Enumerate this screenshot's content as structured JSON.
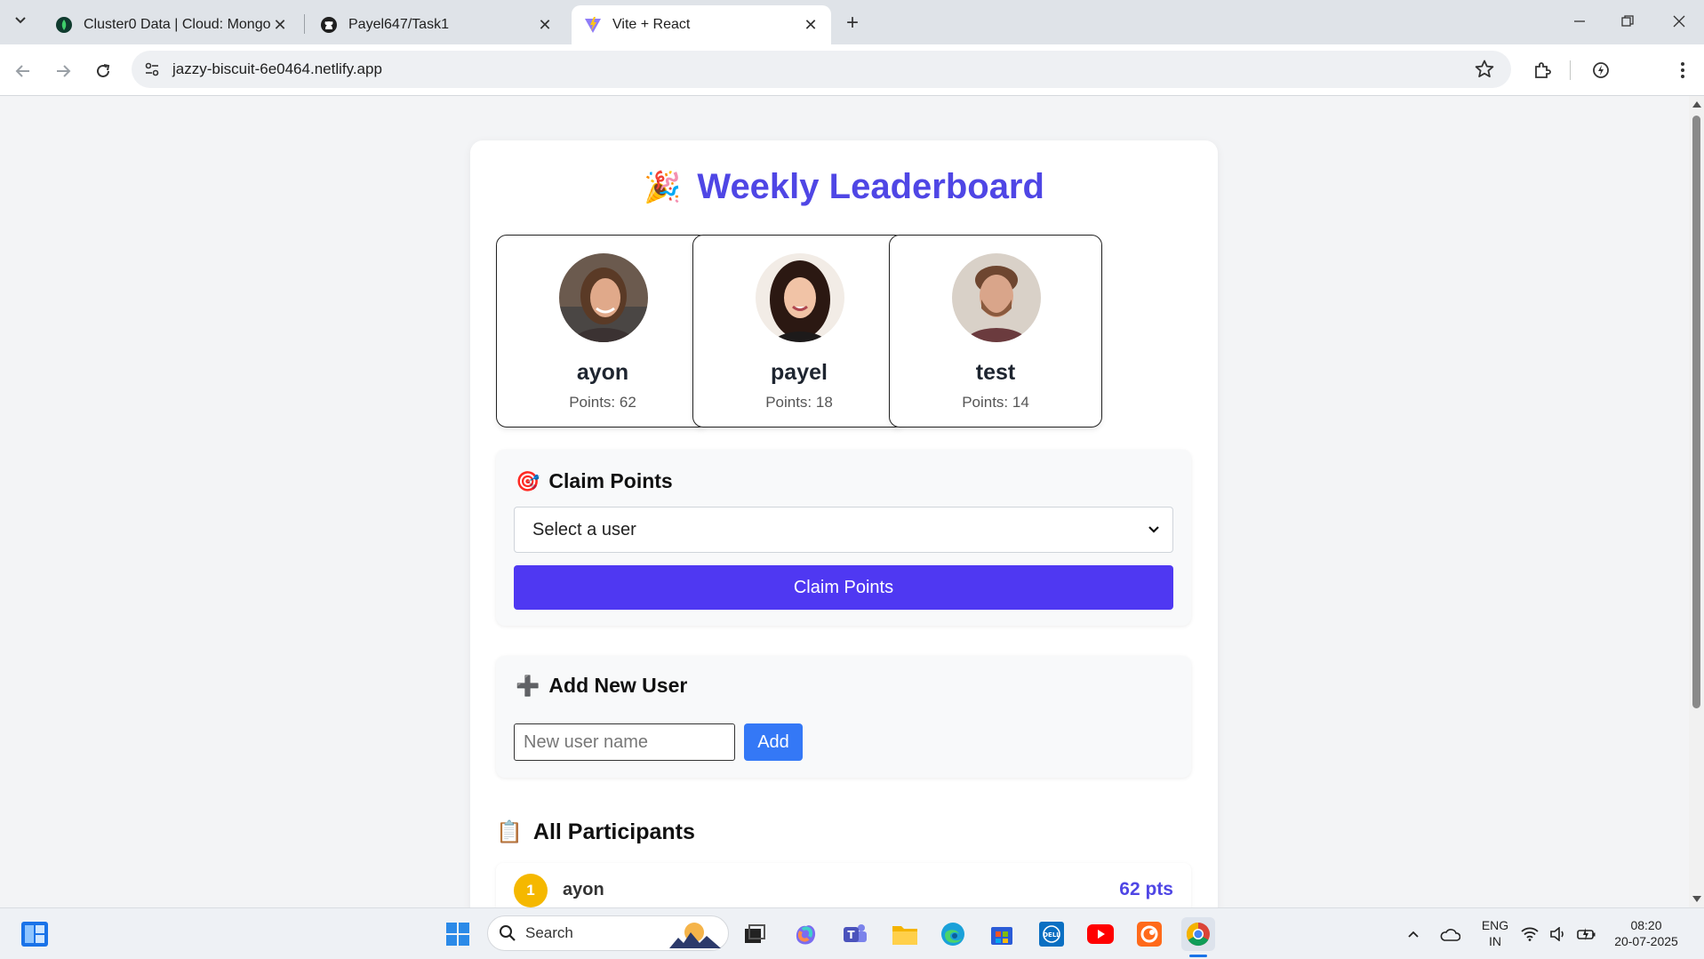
{
  "browser": {
    "tabs": [
      {
        "title": "Cluster0 Data | Cloud: MongoDB",
        "favicon": "mongodb-leaf-icon",
        "active": false
      },
      {
        "title": "Payel647/Task1",
        "favicon": "github-icon",
        "active": false
      },
      {
        "title": "Vite + React",
        "favicon": "vite-icon",
        "active": true
      }
    ],
    "url": "jazzy-biscuit-6e0464.netlify.app"
  },
  "page": {
    "title_emoji": "🎉",
    "title": "Weekly Leaderboard",
    "podium": [
      {
        "name": "ayon",
        "points_label": "Points: 62"
      },
      {
        "name": "payel",
        "points_label": "Points: 18"
      },
      {
        "name": "test",
        "points_label": "Points: 14"
      }
    ],
    "claim": {
      "emoji": "🎯",
      "heading": "Claim Points",
      "select_value": "Select a user",
      "button_label": "Claim Points"
    },
    "add_user": {
      "emoji": "➕",
      "heading": "Add New User",
      "input_placeholder": "New user name",
      "button_label": "Add"
    },
    "participants": {
      "emoji": "📋",
      "heading": "All Participants",
      "rows": [
        {
          "rank": "1",
          "name": "ayon",
          "points": "62 pts"
        }
      ]
    }
  },
  "taskbar": {
    "search_label": "Search",
    "language": "ENG",
    "region": "IN",
    "time": "08:20",
    "date": "20-07-2025"
  },
  "colors": {
    "accent": "#4f46e5",
    "claim_button": "#4f38f2",
    "add_button": "#3478f6",
    "rank_gold": "#f5b800"
  }
}
